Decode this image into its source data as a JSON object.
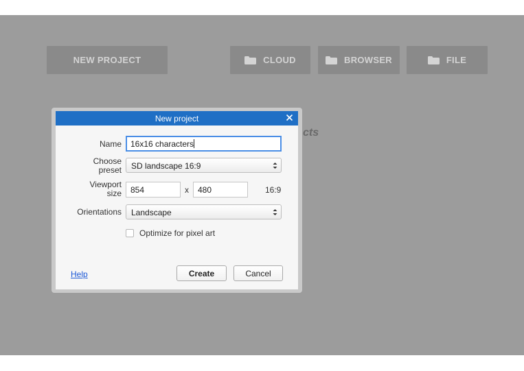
{
  "toolbar": {
    "new_project": "NEW PROJECT",
    "cloud": "CLOUD",
    "browser": "BROWSER",
    "file": "FILE"
  },
  "background_heading_fragment": "cts",
  "dialog": {
    "title": "New project",
    "name_label": "Name",
    "name_value": "16x16 characters",
    "preset_label_1": "Choose",
    "preset_label_2": "preset",
    "preset_value": "SD landscape 16:9",
    "viewport_label_1": "Viewport",
    "viewport_label_2": "size",
    "viewport_width": "854",
    "viewport_x": "x",
    "viewport_height": "480",
    "aspect_ratio": "16:9",
    "orientations_label": "Orientations",
    "orientation_value": "Landscape",
    "pixel_art_label": "Optimize for pixel art",
    "pixel_art_checked": false,
    "help_link": "Help",
    "create_button": "Create",
    "cancel_button": "Cancel"
  },
  "colors": {
    "overlay": "#9c9c9c",
    "toolbar_button": "#8a8a8a",
    "titlebar": "#1f6fc5",
    "focus_ring": "#4a8ee6",
    "link": "#1a57d6"
  }
}
